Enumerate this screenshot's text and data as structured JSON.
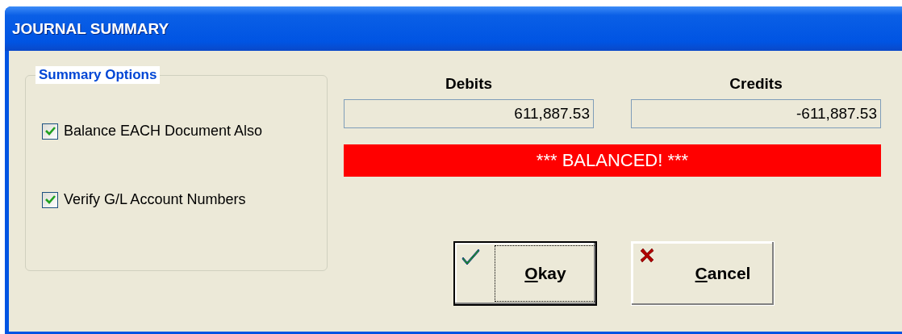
{
  "window": {
    "title": "JOURNAL SUMMARY"
  },
  "options": {
    "title": "Summary Options",
    "items": [
      {
        "label": "Balance EACH Document Also",
        "checked": true
      },
      {
        "label": "Verify G/L Account Numbers",
        "checked": true
      }
    ]
  },
  "totals": [
    {
      "label": "Debits",
      "value": "611,887.53"
    },
    {
      "label": "Credits",
      "value": "-611,887.53"
    }
  ],
  "status": {
    "text": "*** BALANCED! ***",
    "balanced": true
  },
  "buttons": [
    {
      "label": "Okay",
      "kind": "ok",
      "focused": true
    },
    {
      "label": "Cancel",
      "kind": "cancel",
      "focused": false
    }
  ]
}
